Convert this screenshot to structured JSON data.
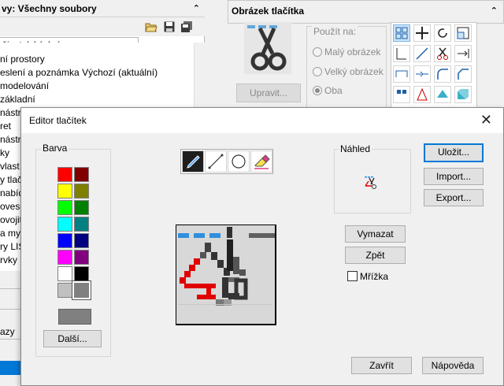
{
  "left_panel": {
    "title": "vy: Všechny soubory",
    "select_value": "živatelských úprav",
    "toolbar_icons": [
      "open-folder-icon",
      "save-icon",
      "save-all-icon"
    ],
    "items": [
      "ní prostory",
      "eslení a poznámka Výchozí (aktuální)",
      "modelování",
      "základní",
      "nástr",
      "ret",
      "nástr",
      "ky",
      "vlast",
      "y tlač",
      "nabídk",
      "ovesé z",
      "ovojitý",
      "a myš",
      "ry LIS",
      "rvky"
    ],
    "footer_text": "azy"
  },
  "right_panel": {
    "title": "Obrázek tlačítka",
    "edit_button": "Upravit...",
    "group_label": "Použít na:",
    "options": [
      "Malý obrázek",
      "Velký obrázek",
      "Oba"
    ],
    "selected_option": "Oba",
    "icons": [
      "grid-icon",
      "move-icon",
      "rotate-icon",
      "scale-icon",
      "trim-icon",
      "line-icon",
      "scissors-icon",
      "extend-icon",
      "break-icon",
      "join-icon",
      "fillet-icon",
      "chamfer-icon",
      "array-icon",
      "explode-icon",
      "region-icon",
      "solid-icon"
    ]
  },
  "dialog": {
    "title": "Editor tlačítek",
    "close_icon": "close-icon",
    "color_group_label": "Barva",
    "colors": [
      [
        "#ff0000",
        "#800000"
      ],
      [
        "#ffff00",
        "#808000"
      ],
      [
        "#00ff00",
        "#008000"
      ],
      [
        "#00ffff",
        "#008080"
      ],
      [
        "#0000ff",
        "#000080"
      ],
      [
        "#ff00ff",
        "#800080"
      ],
      [
        "#ffffff",
        "#000000"
      ],
      [
        "#c0c0c0",
        "#808080"
      ]
    ],
    "selected_color": "#808080",
    "more_colors_button": "Další...",
    "tools": [
      "pencil-icon",
      "line-icon",
      "circle-icon",
      "eraser-icon"
    ],
    "active_tool": "pencil-icon",
    "preview_label": "Náhled",
    "save_button": "Uložit...",
    "import_button": "Import...",
    "export_button": "Export...",
    "clear_button": "Vymazat",
    "undo_button": "Zpět",
    "grid_checkbox": "Mřížka",
    "grid_checked": false,
    "close_button": "Zavřít",
    "help_button": "Nápověda"
  }
}
